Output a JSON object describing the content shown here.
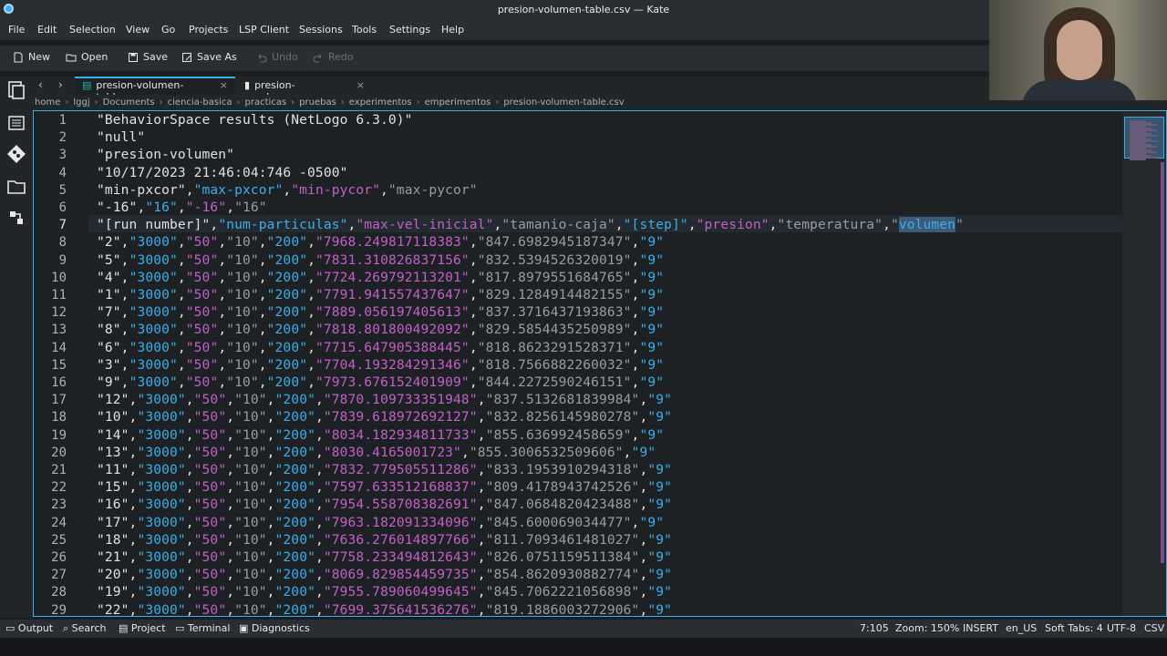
{
  "window": {
    "title": "presion-volumen-table.csv — Kate"
  },
  "menu": [
    "File",
    "Edit",
    "Selection",
    "View",
    "Go",
    "Projects",
    "LSP Client",
    "Sessions",
    "Tools",
    "Settings",
    "Help"
  ],
  "toolbar": {
    "new": "New",
    "open": "Open",
    "save": "Save",
    "save_as": "Save As",
    "undo": "Undo",
    "redo": "Redo"
  },
  "tabs": [
    {
      "label": "presion-volumen-table.csv",
      "close": "×"
    },
    {
      "label": "presion-volumen.py",
      "close": "×"
    }
  ],
  "nav": {
    "back": "‹",
    "forward": "›"
  },
  "breadcrumb": [
    "home",
    "lggj",
    "Documents",
    "ciencia-basica",
    "practicas",
    "pruebas",
    "experimentos",
    "emperimentos",
    "presion-volumen-table.csv"
  ],
  "editor": {
    "lines": [
      "\"BehaviorSpace results (NetLogo 6.3.0)\"",
      "\"null\"",
      "\"presion-volumen\"",
      "\"10/17/2023 21:46:04:746 -0500\"",
      "\"min-pxcor\",\"max-pxcor\",\"min-pycor\",\"max-pycor\"",
      "\"-16\",\"16\",\"-16\",\"16\"",
      "\"[run number]\",\"num-particulas\",\"max-vel-inicial\",\"tamanio-caja\",\"[step]\",\"presion\",\"temperatura\",\"volumen\"",
      "\"2\",\"3000\",\"50\",\"10\",\"200\",\"7968.249817118383\",\"847.6982945187347\",\"9\"",
      "\"5\",\"3000\",\"50\",\"10\",\"200\",\"7831.310826837156\",\"832.5394526320019\",\"9\"",
      "\"4\",\"3000\",\"50\",\"10\",\"200\",\"7724.269792113201\",\"817.8979551684765\",\"9\"",
      "\"1\",\"3000\",\"50\",\"10\",\"200\",\"7791.941557437647\",\"829.1284914482155\",\"9\"",
      "\"7\",\"3000\",\"50\",\"10\",\"200\",\"7889.056197405613\",\"837.3716437193863\",\"9\"",
      "\"8\",\"3000\",\"50\",\"10\",\"200\",\"7818.801800492092\",\"829.5854435250989\",\"9\"",
      "\"6\",\"3000\",\"50\",\"10\",\"200\",\"7715.647905388445\",\"818.8623291528371\",\"9\"",
      "\"3\",\"3000\",\"50\",\"10\",\"200\",\"7704.193284291346\",\"818.7566882260032\",\"9\"",
      "\"9\",\"3000\",\"50\",\"10\",\"200\",\"7973.676152401909\",\"844.2272590246151\",\"9\"",
      "\"12\",\"3000\",\"50\",\"10\",\"200\",\"7870.109733351948\",\"837.5132681839984\",\"9\"",
      "\"10\",\"3000\",\"50\",\"10\",\"200\",\"7839.618972692127\",\"832.8256145980278\",\"9\"",
      "\"14\",\"3000\",\"50\",\"10\",\"200\",\"8034.182934811733\",\"855.636992458659\",\"9\"",
      "\"13\",\"3000\",\"50\",\"10\",\"200\",\"8030.4165001723\",\"855.3006532509606\",\"9\"",
      "\"11\",\"3000\",\"50\",\"10\",\"200\",\"7832.779505511286\",\"833.1953910294318\",\"9\"",
      "\"15\",\"3000\",\"50\",\"10\",\"200\",\"7597.633512168837\",\"809.4178943742526\",\"9\"",
      "\"16\",\"3000\",\"50\",\"10\",\"200\",\"7954.558708382691\",\"847.0684820423488\",\"9\"",
      "\"17\",\"3000\",\"50\",\"10\",\"200\",\"7963.182091334096\",\"845.600069034477\",\"9\"",
      "\"18\",\"3000\",\"50\",\"10\",\"200\",\"7636.276014897766\",\"811.7093461481027\",\"9\"",
      "\"21\",\"3000\",\"50\",\"10\",\"200\",\"7758.233494812643\",\"826.0751159511384\",\"9\"",
      "\"20\",\"3000\",\"50\",\"10\",\"200\",\"8069.829854459735\",\"854.8620930882774\",\"9\"",
      "\"19\",\"3000\",\"50\",\"10\",\"200\",\"7955.789060499645\",\"845.7062221056898\",\"9\"",
      "\"22\",\"3000\",\"50\",\"10\",\"200\",\"7699.375641536276\",\"819.1886003272906\",\"9\""
    ],
    "current_line": 7,
    "selected_text": "volumen"
  },
  "status": {
    "output": "Output",
    "search": "Search",
    "project": "Project",
    "terminal": "Terminal",
    "diagnostics": "Diagnostics",
    "cursor": "7:105",
    "zoom": "Zoom: 150%",
    "mode": "INSERT",
    "language": "en_US",
    "tabs": "Soft Tabs: 4",
    "encoding": "UTF-8",
    "filetype": "CSV"
  },
  "colors": {
    "accent": "#3daee9",
    "string": "#3daee9",
    "alt_string": "#c160c9",
    "muted": "#9a9ca0"
  }
}
